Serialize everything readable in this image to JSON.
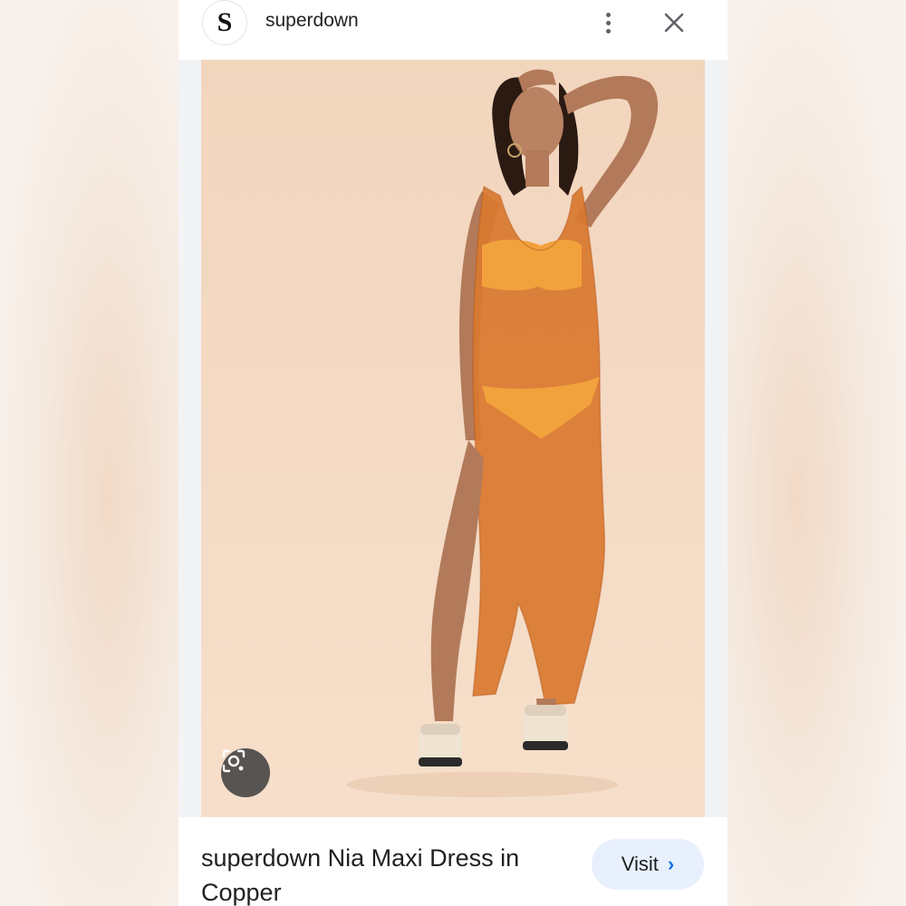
{
  "header": {
    "avatar_letter": "S",
    "site_name": "superdown"
  },
  "icons": {
    "more": "more-vert-icon",
    "close": "close-icon",
    "lens": "google-lens-icon",
    "visit_arrow": "chevron-right-icon"
  },
  "image": {
    "subject": "product-photo"
  },
  "footer": {
    "title": "superdown Nia Maxi Dress in Copper",
    "visit_label": "Visit",
    "visit_arrow": "›"
  },
  "colors": {
    "visit_bg": "#e8f0fe",
    "accent": "#1a73e8",
    "dress": "#d9782f"
  }
}
